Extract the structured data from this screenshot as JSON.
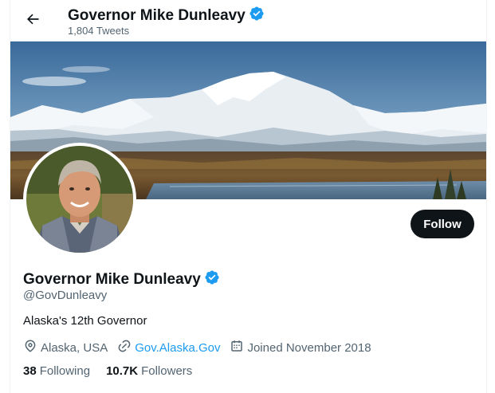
{
  "header": {
    "title": "Governor Mike Dunleavy",
    "tweets_count": "1,804 Tweets",
    "back_icon": "arrow-left-icon",
    "verified_icon": "verified-badge-icon"
  },
  "profile": {
    "name": "Governor Mike Dunleavy",
    "handle": "@GovDunleavy",
    "bio": "Alaska's 12th Governor",
    "location": "Alaska, USA",
    "website": "Gov.Alaska.Gov",
    "joined": "Joined November 2018",
    "following_count": "38",
    "following_label": "Following",
    "followers_count": "10.7K",
    "followers_label": "Followers"
  },
  "actions": {
    "follow_label": "Follow"
  },
  "colors": {
    "accent": "#1d9bf0",
    "text": "#0f1419",
    "muted": "#536471",
    "button_bg": "#0f1419"
  }
}
